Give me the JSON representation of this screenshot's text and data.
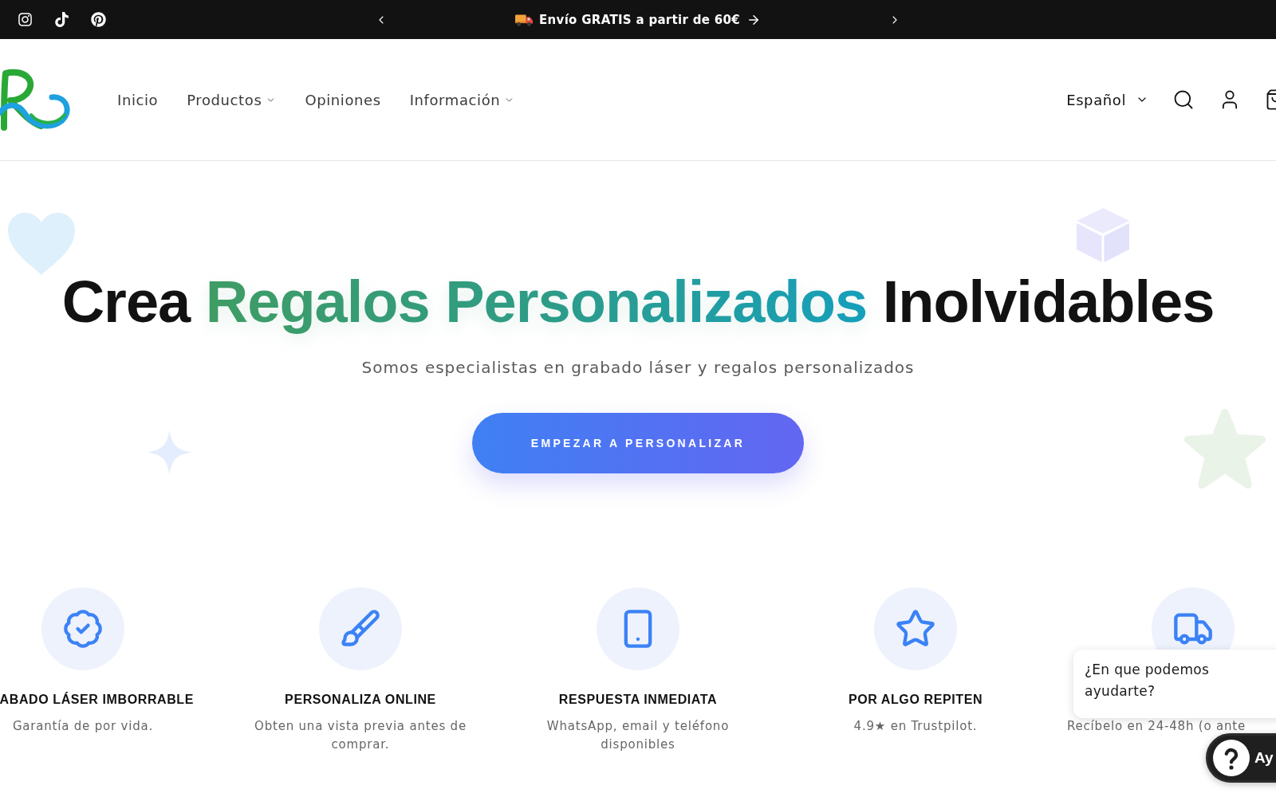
{
  "announcement": {
    "message": "Envío GRATIS a partir de 60€"
  },
  "header": {
    "nav": [
      {
        "label": "Inicio",
        "has_dropdown": false
      },
      {
        "label": "Productos",
        "has_dropdown": true
      },
      {
        "label": "Opiniones",
        "has_dropdown": false
      },
      {
        "label": "Información",
        "has_dropdown": true
      }
    ],
    "language": "Español"
  },
  "hero": {
    "title": {
      "lead": "Crea",
      "highlight": "Regalos Personalizados",
      "tail": "Inolvidables"
    },
    "subtitle": "Somos especialistas en grabado láser y regalos personalizados",
    "cta": "EMPEZAR A PERSONALIZAR"
  },
  "features": [
    {
      "title": "ABADO LÁSER IMBORRABLE",
      "description": "Garantía de por vida."
    },
    {
      "title": "PERSONALIZA ONLINE",
      "description": "Obten una vista previa antes de comprar."
    },
    {
      "title": "RESPUESTA INMEDIATA",
      "description": "WhatsApp, email y teléfono disponibles"
    },
    {
      "title": "POR ALGO REPITEN",
      "description": "4.9★ en Trustpilot."
    },
    {
      "description": "Recíbelo en 24-48h (o ante"
    }
  ],
  "chat_widget": {
    "prompt": "¿En que podemos ayudarte?",
    "button_label": "Ay"
  }
}
